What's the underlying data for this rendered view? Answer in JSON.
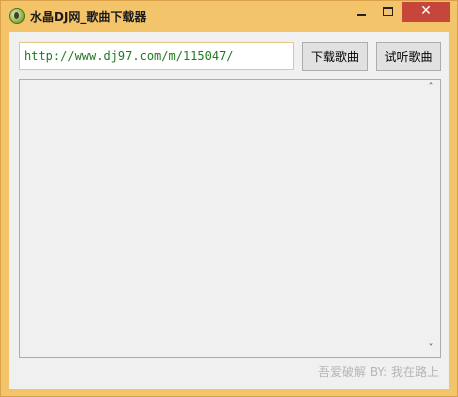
{
  "window": {
    "title": "水晶DJ网_歌曲下载器",
    "close_glyph": "✕",
    "icon": "crystal-dj-app-icon"
  },
  "form": {
    "url_value": "http://www.dj97.com/m/115047/",
    "download_label": "下载歌曲",
    "listen_label": "试听歌曲"
  },
  "list": {
    "scroll_up_glyph": "˄",
    "scroll_down_glyph": "˅"
  },
  "footer": {
    "credit": "吾爱破解 BY: 我在路上"
  },
  "colors": {
    "frame": "#f4c46a",
    "close_button": "#c7463b",
    "url_text": "#1f7a1f",
    "credit_text": "#b5b5b5"
  }
}
